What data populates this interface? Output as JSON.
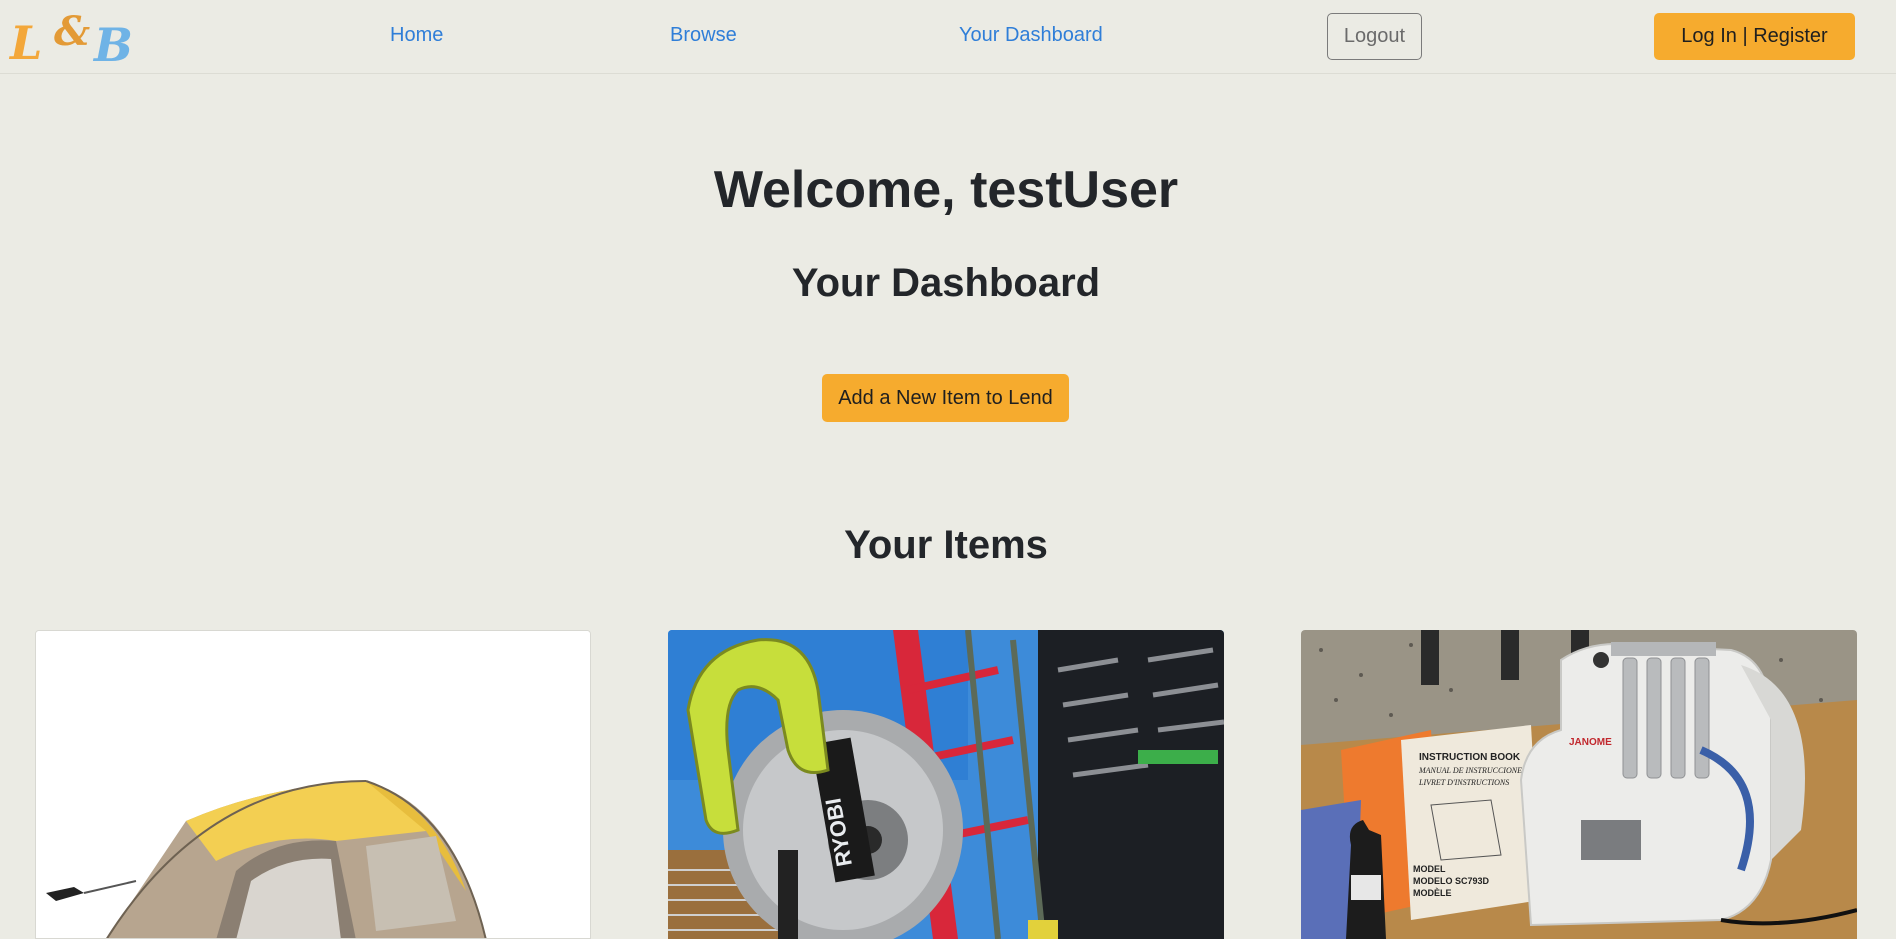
{
  "nav": {
    "logo": {
      "l": "L",
      "amp": "&",
      "b": "B"
    },
    "links": [
      "Home",
      "Browse",
      "Your Dashboard"
    ],
    "logout_label": "Logout",
    "login_label": "Log In | Register"
  },
  "main": {
    "welcome": "Welcome, testUser",
    "dashboard_title": "Your Dashboard",
    "add_item_label": "Add a New Item to Lend",
    "items_title": "Your Items"
  },
  "items": [
    {
      "image": "tent-photo"
    },
    {
      "image": "miter-saw-photo",
      "brand_text": "RYOBI"
    },
    {
      "image": "serger-photo",
      "brand_text": "JANOME",
      "book_lines": [
        "INSTRUCTION BOOK",
        "MANUAL DE INSTRUCCIONES",
        "LIVRET D'INSTRUCTIONS"
      ],
      "model_lines": [
        "MODEL",
        "MODELO SC793D",
        "MODÈLE"
      ]
    }
  ],
  "colors": {
    "background": "#ebebe4",
    "accent": "#f6ab2e",
    "link": "#2f7ed8"
  }
}
